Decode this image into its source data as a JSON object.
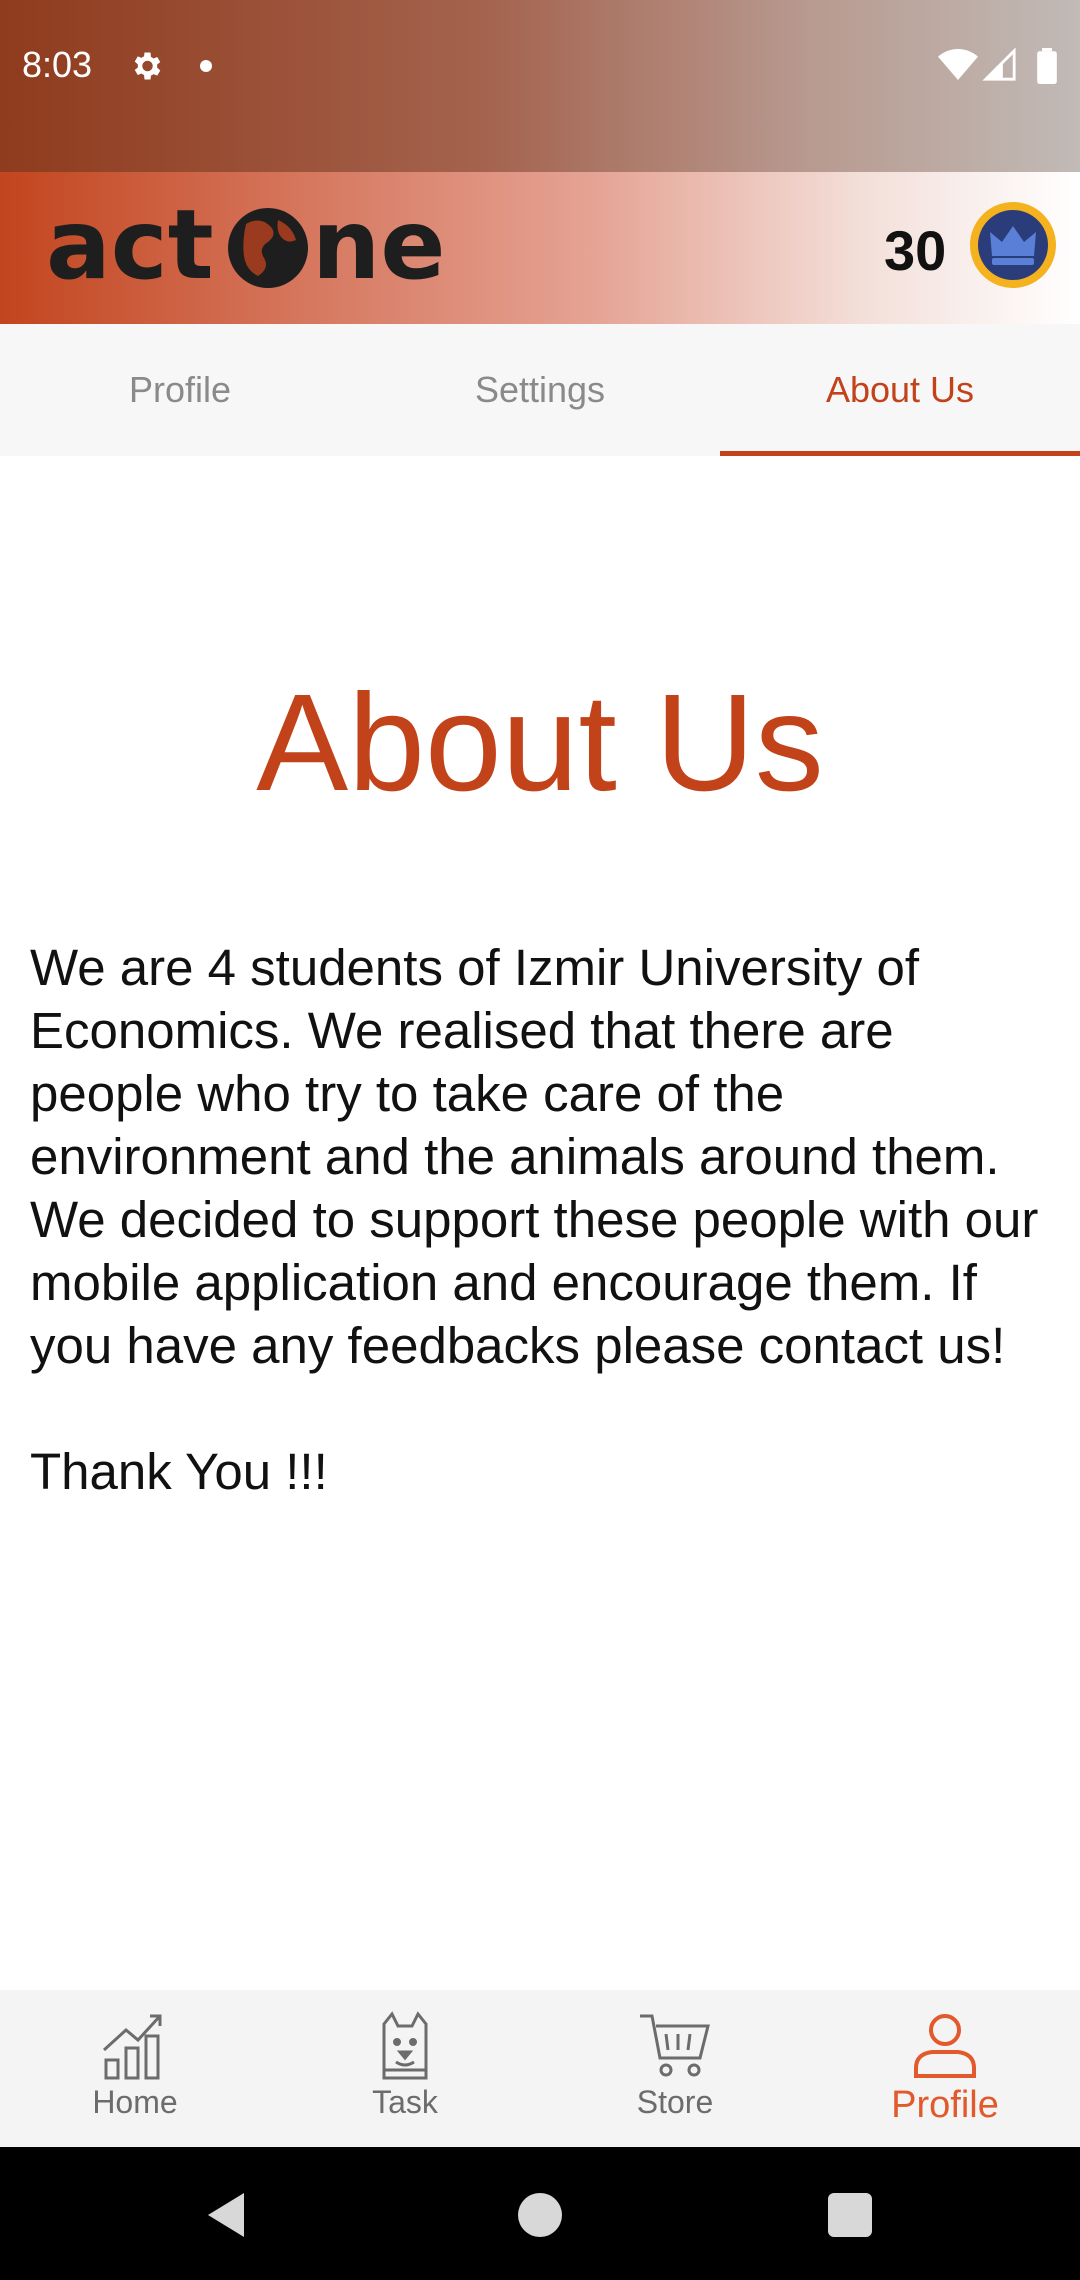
{
  "status_bar": {
    "time": "8:03",
    "icons": [
      "gear-icon",
      "notification-dot",
      "wifi-icon",
      "signal-icon",
      "battery-icon"
    ]
  },
  "header": {
    "logo_text": "actone",
    "points": "30",
    "coin_icon": "crown-coin-icon"
  },
  "tabs": [
    {
      "label": "Profile",
      "active": false
    },
    {
      "label": "Settings",
      "active": false
    },
    {
      "label": "About Us",
      "active": true
    }
  ],
  "content": {
    "title": "About Us",
    "body": "We are 4 students of Izmir University of Economics. We realised that there are people who try to take care of the environment and the animals around them. We decided to support these people with our mobile application and encourage them. If you have any feedbacks please contact us!\n\n Thank You !!!"
  },
  "bottom_nav": [
    {
      "label": "Home",
      "icon": "chart-icon",
      "active": false
    },
    {
      "label": "Task",
      "icon": "dog-icon",
      "active": false
    },
    {
      "label": "Store",
      "icon": "cart-icon",
      "active": false
    },
    {
      "label": "Profile",
      "icon": "person-icon",
      "active": true
    }
  ],
  "colors": {
    "accent": "#c2421a",
    "nav_active": "#e2592c",
    "inactive": "#8a8a8a"
  }
}
